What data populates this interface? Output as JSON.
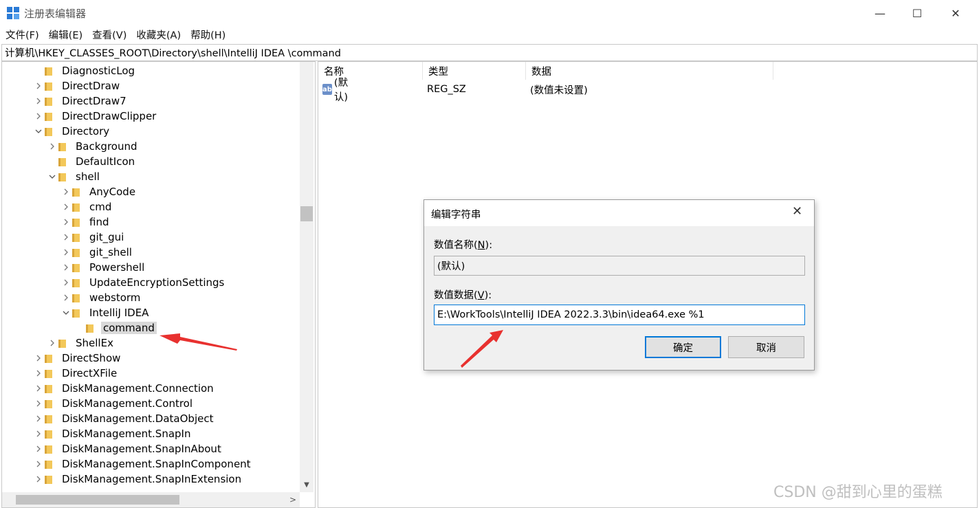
{
  "window": {
    "title": "注册表编辑器",
    "min_glyph": "—",
    "max_glyph": "☐",
    "close_glyph": "✕"
  },
  "menu": [
    "文件(F)",
    "编辑(E)",
    "查看(V)",
    "收藏夹(A)",
    "帮助(H)"
  ],
  "address": "计算机\\HKEY_CLASSES_ROOT\\Directory\\shell\\IntelliJ IDEA \\command",
  "tree": [
    {
      "label": "DiagnosticLog",
      "level": 0,
      "arrow": ""
    },
    {
      "label": "DirectDraw",
      "level": 0,
      "arrow": ">"
    },
    {
      "label": "DirectDraw7",
      "level": 0,
      "arrow": ">"
    },
    {
      "label": "DirectDrawClipper",
      "level": 0,
      "arrow": ">"
    },
    {
      "label": "Directory",
      "level": 0,
      "arrow": "v"
    },
    {
      "label": "Background",
      "level": 1,
      "arrow": ">"
    },
    {
      "label": "DefaultIcon",
      "level": 1,
      "arrow": ""
    },
    {
      "label": "shell",
      "level": 1,
      "arrow": "v"
    },
    {
      "label": "AnyCode",
      "level": 2,
      "arrow": ">"
    },
    {
      "label": "cmd",
      "level": 2,
      "arrow": ">"
    },
    {
      "label": "find",
      "level": 2,
      "arrow": ">"
    },
    {
      "label": "git_gui",
      "level": 2,
      "arrow": ">"
    },
    {
      "label": "git_shell",
      "level": 2,
      "arrow": ">"
    },
    {
      "label": "Powershell",
      "level": 2,
      "arrow": ">"
    },
    {
      "label": "UpdateEncryptionSettings",
      "level": 2,
      "arrow": ">"
    },
    {
      "label": "webstorm",
      "level": 2,
      "arrow": ">"
    },
    {
      "label": "IntelliJ IDEA",
      "level": 2,
      "arrow": "v"
    },
    {
      "label": "command",
      "level": 3,
      "arrow": "",
      "selected": true
    },
    {
      "label": "ShellEx",
      "level": 1,
      "arrow": ">"
    },
    {
      "label": "DirectShow",
      "level": 0,
      "arrow": ">"
    },
    {
      "label": "DirectXFile",
      "level": 0,
      "arrow": ">"
    },
    {
      "label": "DiskManagement.Connection",
      "level": 0,
      "arrow": ">"
    },
    {
      "label": "DiskManagement.Control",
      "level": 0,
      "arrow": ">"
    },
    {
      "label": "DiskManagement.DataObject",
      "level": 0,
      "arrow": ">"
    },
    {
      "label": "DiskManagement.SnapIn",
      "level": 0,
      "arrow": ">"
    },
    {
      "label": "DiskManagement.SnapInAbout",
      "level": 0,
      "arrow": ">"
    },
    {
      "label": "DiskManagement.SnapInComponent",
      "level": 0,
      "arrow": ">"
    },
    {
      "label": "DiskManagement.SnapInExtension",
      "level": 0,
      "arrow": ">"
    }
  ],
  "columns": {
    "name": "名称",
    "type": "类型",
    "data": "数据"
  },
  "values": [
    {
      "icon": "ab",
      "name": "(默认)",
      "type": "REG_SZ",
      "data": "(数值未设置)"
    }
  ],
  "dialog": {
    "title": "编辑字符串",
    "close_glyph": "✕",
    "name_label_pre": "数值名称(",
    "name_label_key": "N",
    "name_label_post": "):",
    "name_value": "(默认)",
    "data_label_pre": "数值数据(",
    "data_label_key": "V",
    "data_label_post": "):",
    "data_value": "E:\\WorkTools\\IntelliJ IDEA 2022.3.3\\bin\\idea64.exe %1",
    "ok_label": "确定",
    "cancel_label": "取消"
  },
  "scroll_glyphs": {
    "down": "▼",
    "right": ">"
  },
  "watermark": "CSDN @甜到心里的蛋糕",
  "colors": {
    "accent": "#0078d7",
    "annotation_arrow": "#e8312f",
    "folder": "#f3c85a"
  }
}
